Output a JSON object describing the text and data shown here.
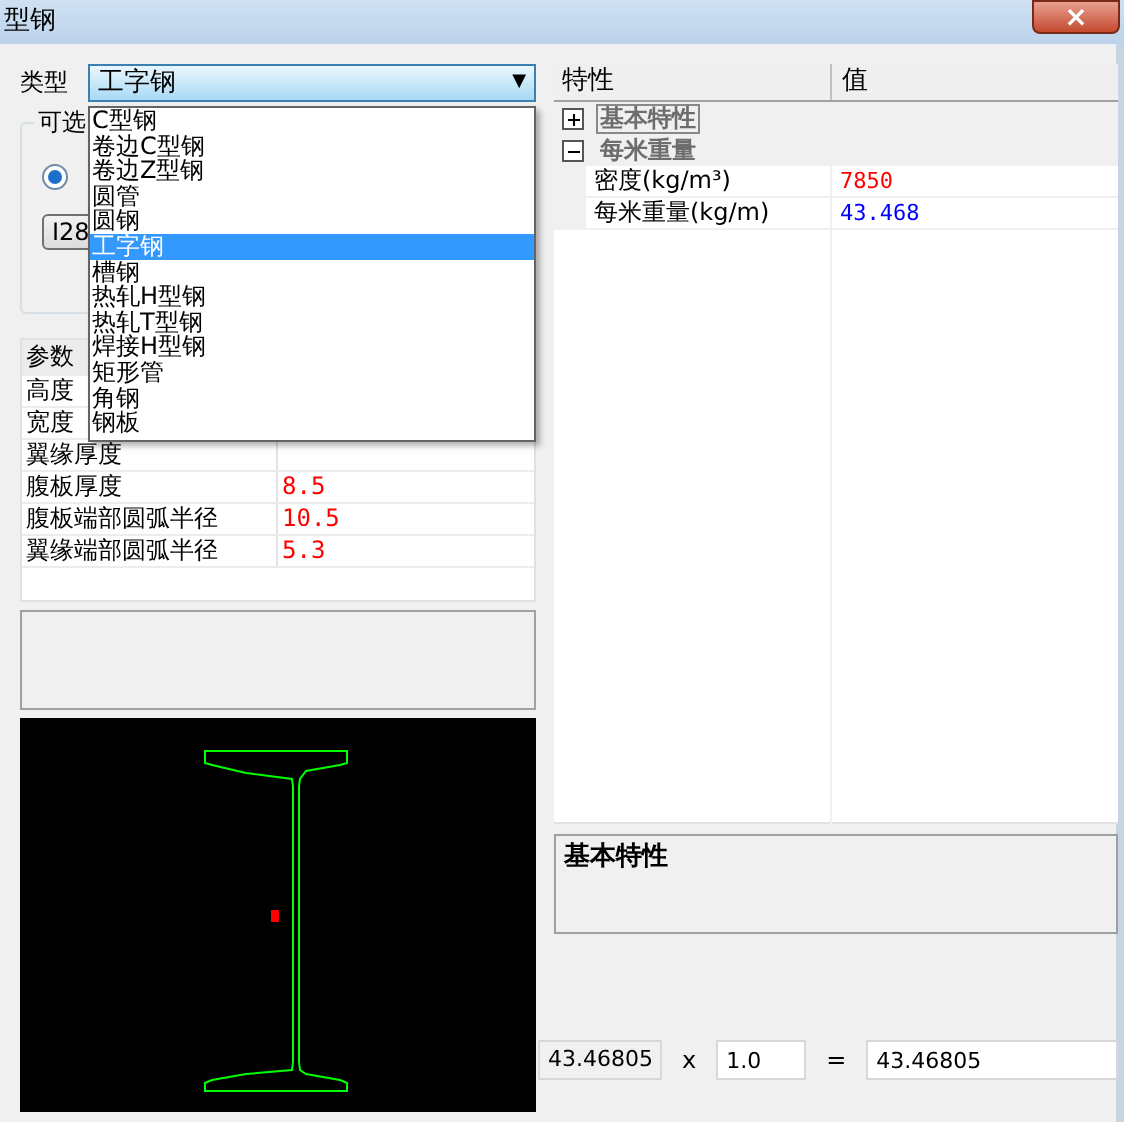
{
  "window": {
    "title": "型钢",
    "close": "×"
  },
  "type_field": {
    "label": "类型",
    "value": "工字钢",
    "caret": "▼"
  },
  "type_options": [
    {
      "label": "C型钢",
      "selected": false
    },
    {
      "label": "卷边C型钢",
      "selected": false
    },
    {
      "label": "卷边Z型钢",
      "selected": false
    },
    {
      "label": "圆管",
      "selected": false
    },
    {
      "label": "圆钢",
      "selected": false
    },
    {
      "label": "工字钢",
      "selected": true
    },
    {
      "label": "槽钢",
      "selected": false
    },
    {
      "label": "热轧H型钢",
      "selected": false
    },
    {
      "label": "热轧T型钢",
      "selected": false
    },
    {
      "label": "焊接H型钢",
      "selected": false
    },
    {
      "label": "矩形管",
      "selected": false
    },
    {
      "label": "角钢",
      "selected": false
    },
    {
      "label": "钢板",
      "selected": false
    }
  ],
  "options_group": {
    "title": "可选",
    "radio_checked": true,
    "button": "I28"
  },
  "params": {
    "column_1": "参数",
    "rows": [
      {
        "name": "高度",
        "value": ""
      },
      {
        "name": "宽度",
        "value": ""
      },
      {
        "name": "翼缘厚度",
        "value": ""
      },
      {
        "name": "腹板厚度",
        "value": "8.5",
        "color": "#ff0000"
      },
      {
        "name": "腹板端部圆弧半径",
        "value": "10.5",
        "color": "#ff0000"
      },
      {
        "name": "翼缘端部圆弧半径",
        "value": "5.3",
        "color": "#ff0000"
      }
    ]
  },
  "properties": {
    "columns": [
      "特性",
      "值"
    ],
    "categories": [
      {
        "label": "基本特性",
        "expanded": false,
        "selected": true
      },
      {
        "label": "每米重量",
        "expanded": true,
        "selected": false,
        "children": [
          {
            "name": "密度(kg/m³)",
            "value": "7850",
            "color": "#ff0000"
          },
          {
            "name": "每米重量(kg/m)",
            "value": "43.468",
            "color": "#0000ff"
          }
        ]
      }
    ]
  },
  "description": {
    "title": "基本特性"
  },
  "calc": {
    "weight": "43.46805",
    "times": "x",
    "factor": "1.0",
    "equals": "=",
    "result": "43.46805"
  }
}
